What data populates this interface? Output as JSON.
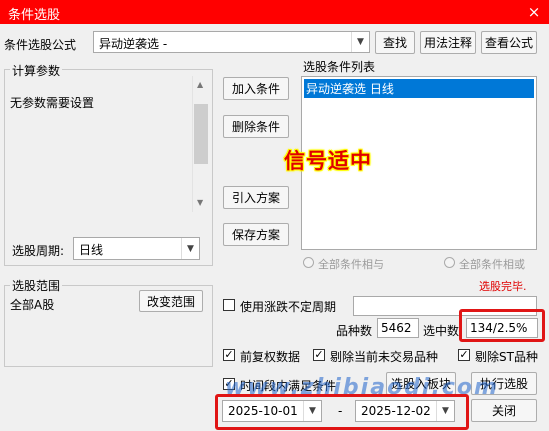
{
  "window": {
    "title": "条件选股",
    "close_icon": "×"
  },
  "formula": {
    "label": "条件选股公式",
    "value": "异动逆袭选  -",
    "find": "查找",
    "usage": "用法注释",
    "view": "查看公式"
  },
  "params": {
    "group_title": "计算参数",
    "text": "无参数需要设置",
    "period_label": "选股周期:",
    "period_value": "日线"
  },
  "buttons": {
    "add": "加入条件",
    "delete": "删除条件",
    "import": "引入方案",
    "save": "保存方案",
    "change_range": "改变范围",
    "to_block": "选股入板块",
    "execute": "执行选股",
    "close": "关闭"
  },
  "conditions": {
    "title": "选股条件列表",
    "items": [
      "异动逆袭选  日线"
    ]
  },
  "overlay": {
    "label": "信号适中"
  },
  "logic": {
    "and": "全部条件相与",
    "or": "全部条件相或"
  },
  "status": {
    "done": "选股完毕."
  },
  "range": {
    "group_title": "选股范围",
    "value": "全部A股"
  },
  "options": {
    "use_irregular": "使用涨跌不定周期",
    "count_label": "品种数",
    "count_value": "5462",
    "selected_label": "选中数",
    "selected_value": "134/2.5%",
    "pre_adjust": "前复权数据",
    "exclude_untraded": "剔除当前未交易品种",
    "exclude_st": "剔除ST品种",
    "period_cond": "时间段内满足条件",
    "check_mark": "✓"
  },
  "dates": {
    "start": "2025-10-01",
    "sep": "-",
    "end": "2025-12-02"
  },
  "watermark": "www.zhibiaodi.com",
  "colors": {
    "title_bar": "#ff0000",
    "highlight": "#e01515",
    "selection": "#0078d7"
  }
}
